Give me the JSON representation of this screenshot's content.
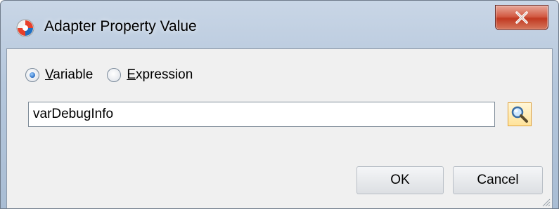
{
  "window": {
    "title": "Adapter Property Value",
    "close_label": "X"
  },
  "mode": {
    "options": [
      {
        "label": "Variable",
        "mnemonic": "V",
        "rest": "ariable",
        "selected": true
      },
      {
        "label": "Expression",
        "mnemonic": "E",
        "rest": "xpression",
        "selected": false
      }
    ]
  },
  "field": {
    "value": "varDebugInfo"
  },
  "buttons": {
    "ok": "OK",
    "cancel": "Cancel"
  },
  "icons": {
    "app": "oracle-app-icon",
    "close": "close-icon",
    "search": "search-icon",
    "grip": "resize-grip-icon"
  },
  "colors": {
    "close_button": "#c13a22",
    "radio_selected": "#2c6fc4",
    "search_button_border": "#e0a23a"
  }
}
